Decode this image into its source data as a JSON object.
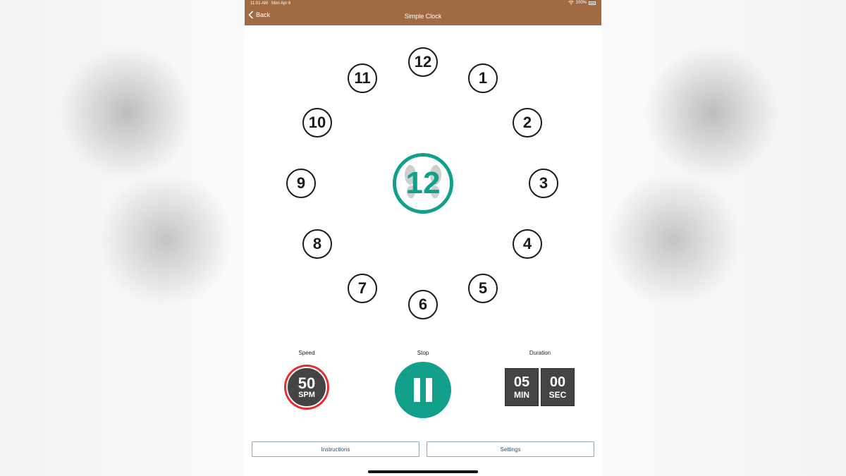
{
  "status_bar": {
    "time": "11:01 AM",
    "date": "Mon Apr 6",
    "battery": "100%"
  },
  "nav": {
    "back_label": "Back",
    "title": "Simple Clock"
  },
  "clock": {
    "numbers": [
      "12",
      "1",
      "2",
      "3",
      "4",
      "5",
      "6",
      "7",
      "8",
      "9",
      "10",
      "11"
    ],
    "center_number": "12"
  },
  "controls": {
    "speed": {
      "label": "Speed",
      "value": "50",
      "unit": "SPM"
    },
    "stop": {
      "label": "Stop"
    },
    "duration": {
      "label": "Duration",
      "minutes": "05",
      "minutes_unit": "MIN",
      "seconds": "00",
      "seconds_unit": "SEC"
    }
  },
  "buttons": {
    "instructions": "Instructions",
    "settings": "Settings"
  },
  "colors": {
    "nav_bar": "#a06a42",
    "accent": "#12a08b",
    "speed_ring": "#e52d2d",
    "tile_dark": "#444444"
  }
}
